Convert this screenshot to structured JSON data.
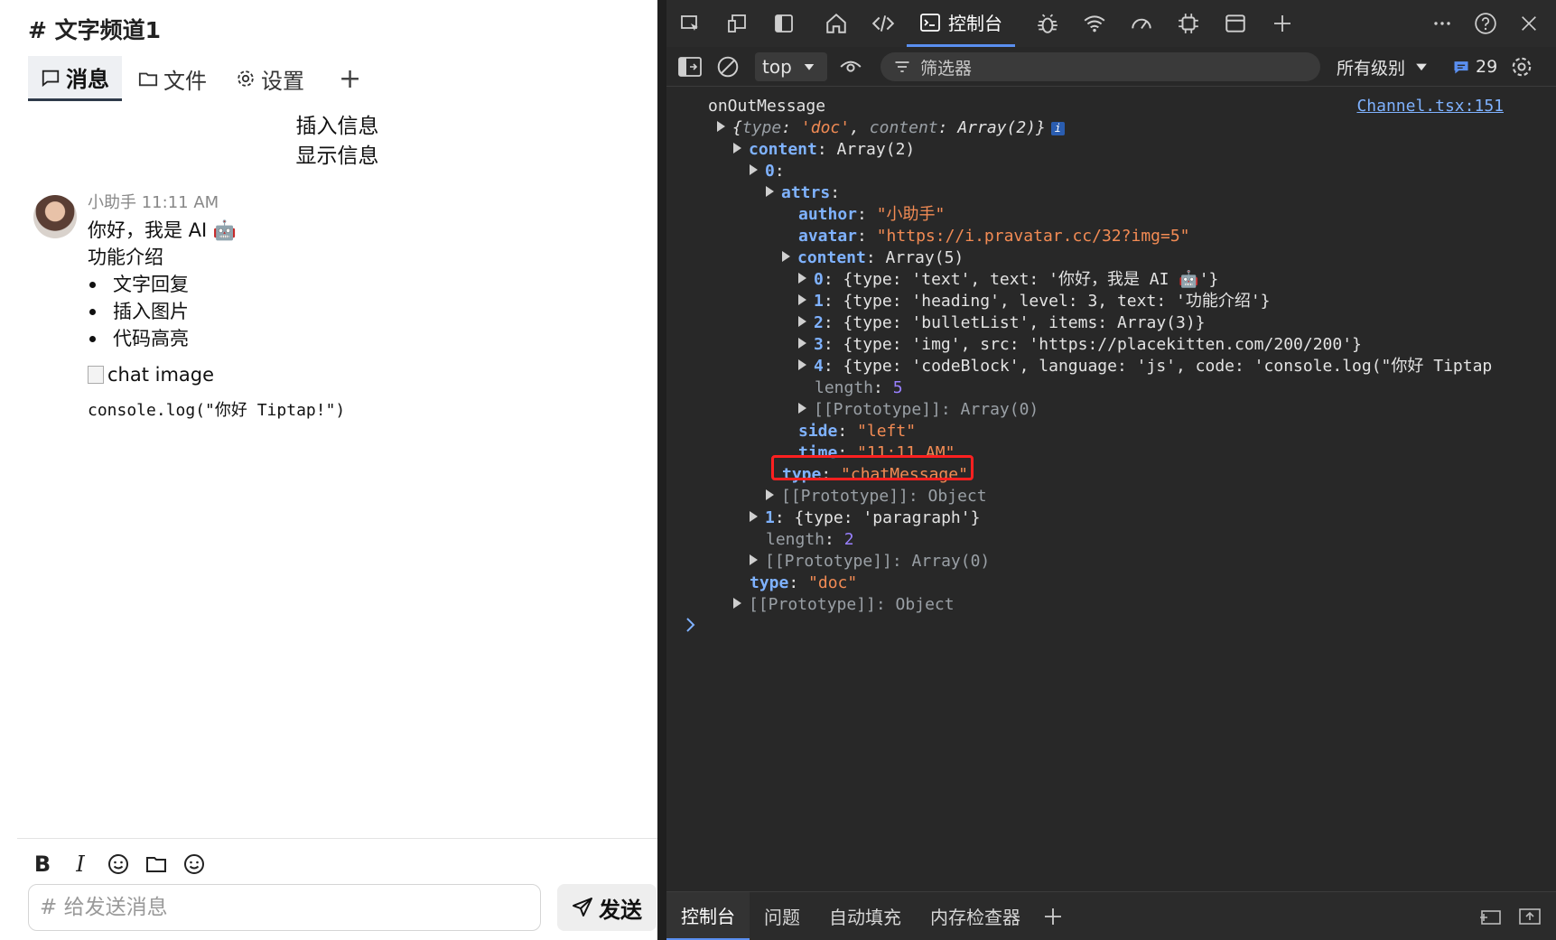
{
  "app": {
    "channel_title": "# 文字频道1",
    "tabs": [
      {
        "label": "消息",
        "icon": "chat-bubble-icon",
        "active": true
      },
      {
        "label": "文件",
        "icon": "folder-icon",
        "active": false
      },
      {
        "label": "设置",
        "icon": "gear-icon",
        "active": false
      }
    ],
    "add_tab": "+",
    "insert_link": "插入信息",
    "show_link": "显示信息",
    "message": {
      "author": "小助手",
      "time": "11:11 AM",
      "text": "你好，我是 AI 🤖",
      "heading": "功能介绍",
      "bullets": [
        "文字回复",
        "插入图片",
        "代码高亮"
      ],
      "image_alt": "chat image",
      "code": "console.log(\"你好 Tiptap!\")"
    },
    "toolbar": [
      "B",
      "I",
      "smile-icon",
      "folder-icon",
      "smile-icon"
    ],
    "input_placeholder": "# 给发送消息",
    "send_label": "发送"
  },
  "devtools": {
    "console_tab": "控制台",
    "context": "top",
    "filter_placeholder": "筛选器",
    "levels": "所有级别",
    "issue_count": "29",
    "log_label": "onOutMessage",
    "source_link": "Channel.tsx:151",
    "lines": {
      "summary_a": "{",
      "summary_type_k": "type",
      "summary_type_v": "'doc'",
      "summary_content_k": "content",
      "summary_content_v": "Array(2)}",
      "content_k": "content",
      "content_v": "Array(2)",
      "idx0": "0",
      "attrs": "attrs",
      "author_k": "author",
      "author_v": "\"小助手\"",
      "avatar_k": "avatar",
      "avatar_v": "\"https://i.pravatar.cc/32?img=5\"",
      "content2_k": "content",
      "content2_v": "Array(5)",
      "c0": "{type: 'text', text: '你好，我是 AI 🤖'}",
      "c1": "{type: 'heading', level: 3, text: '功能介绍'}",
      "c2": "{type: 'bulletList', items: Array(3)}",
      "c3": "{type: 'img', src: 'https://placekitten.com/200/200'}",
      "c4": "{type: 'codeBlock', language: 'js', code: 'console.log(\"你好 Tiptap",
      "length5_k": "length",
      "length5_v": "5",
      "proto_arr": "[[Prototype]]: Array(0)",
      "side_k": "side",
      "side_v": "\"left\"",
      "time_k": "time",
      "time_v": "\"11:11 AM\"",
      "type_k": "type",
      "type_v": "\"chatMessage\"",
      "proto_obj": "[[Prototype]]: Object",
      "one": "{type: 'paragraph'}",
      "length2_k": "length",
      "length2_v": "2",
      "proto_arr2": "[[Prototype]]: Array(0)",
      "type_doc_k": "type",
      "type_doc_v": "\"doc\"",
      "proto_obj2": "[[Prototype]]: Object"
    },
    "drawer_tabs": [
      "控制台",
      "问题",
      "自动填充",
      "内存检查器"
    ]
  }
}
